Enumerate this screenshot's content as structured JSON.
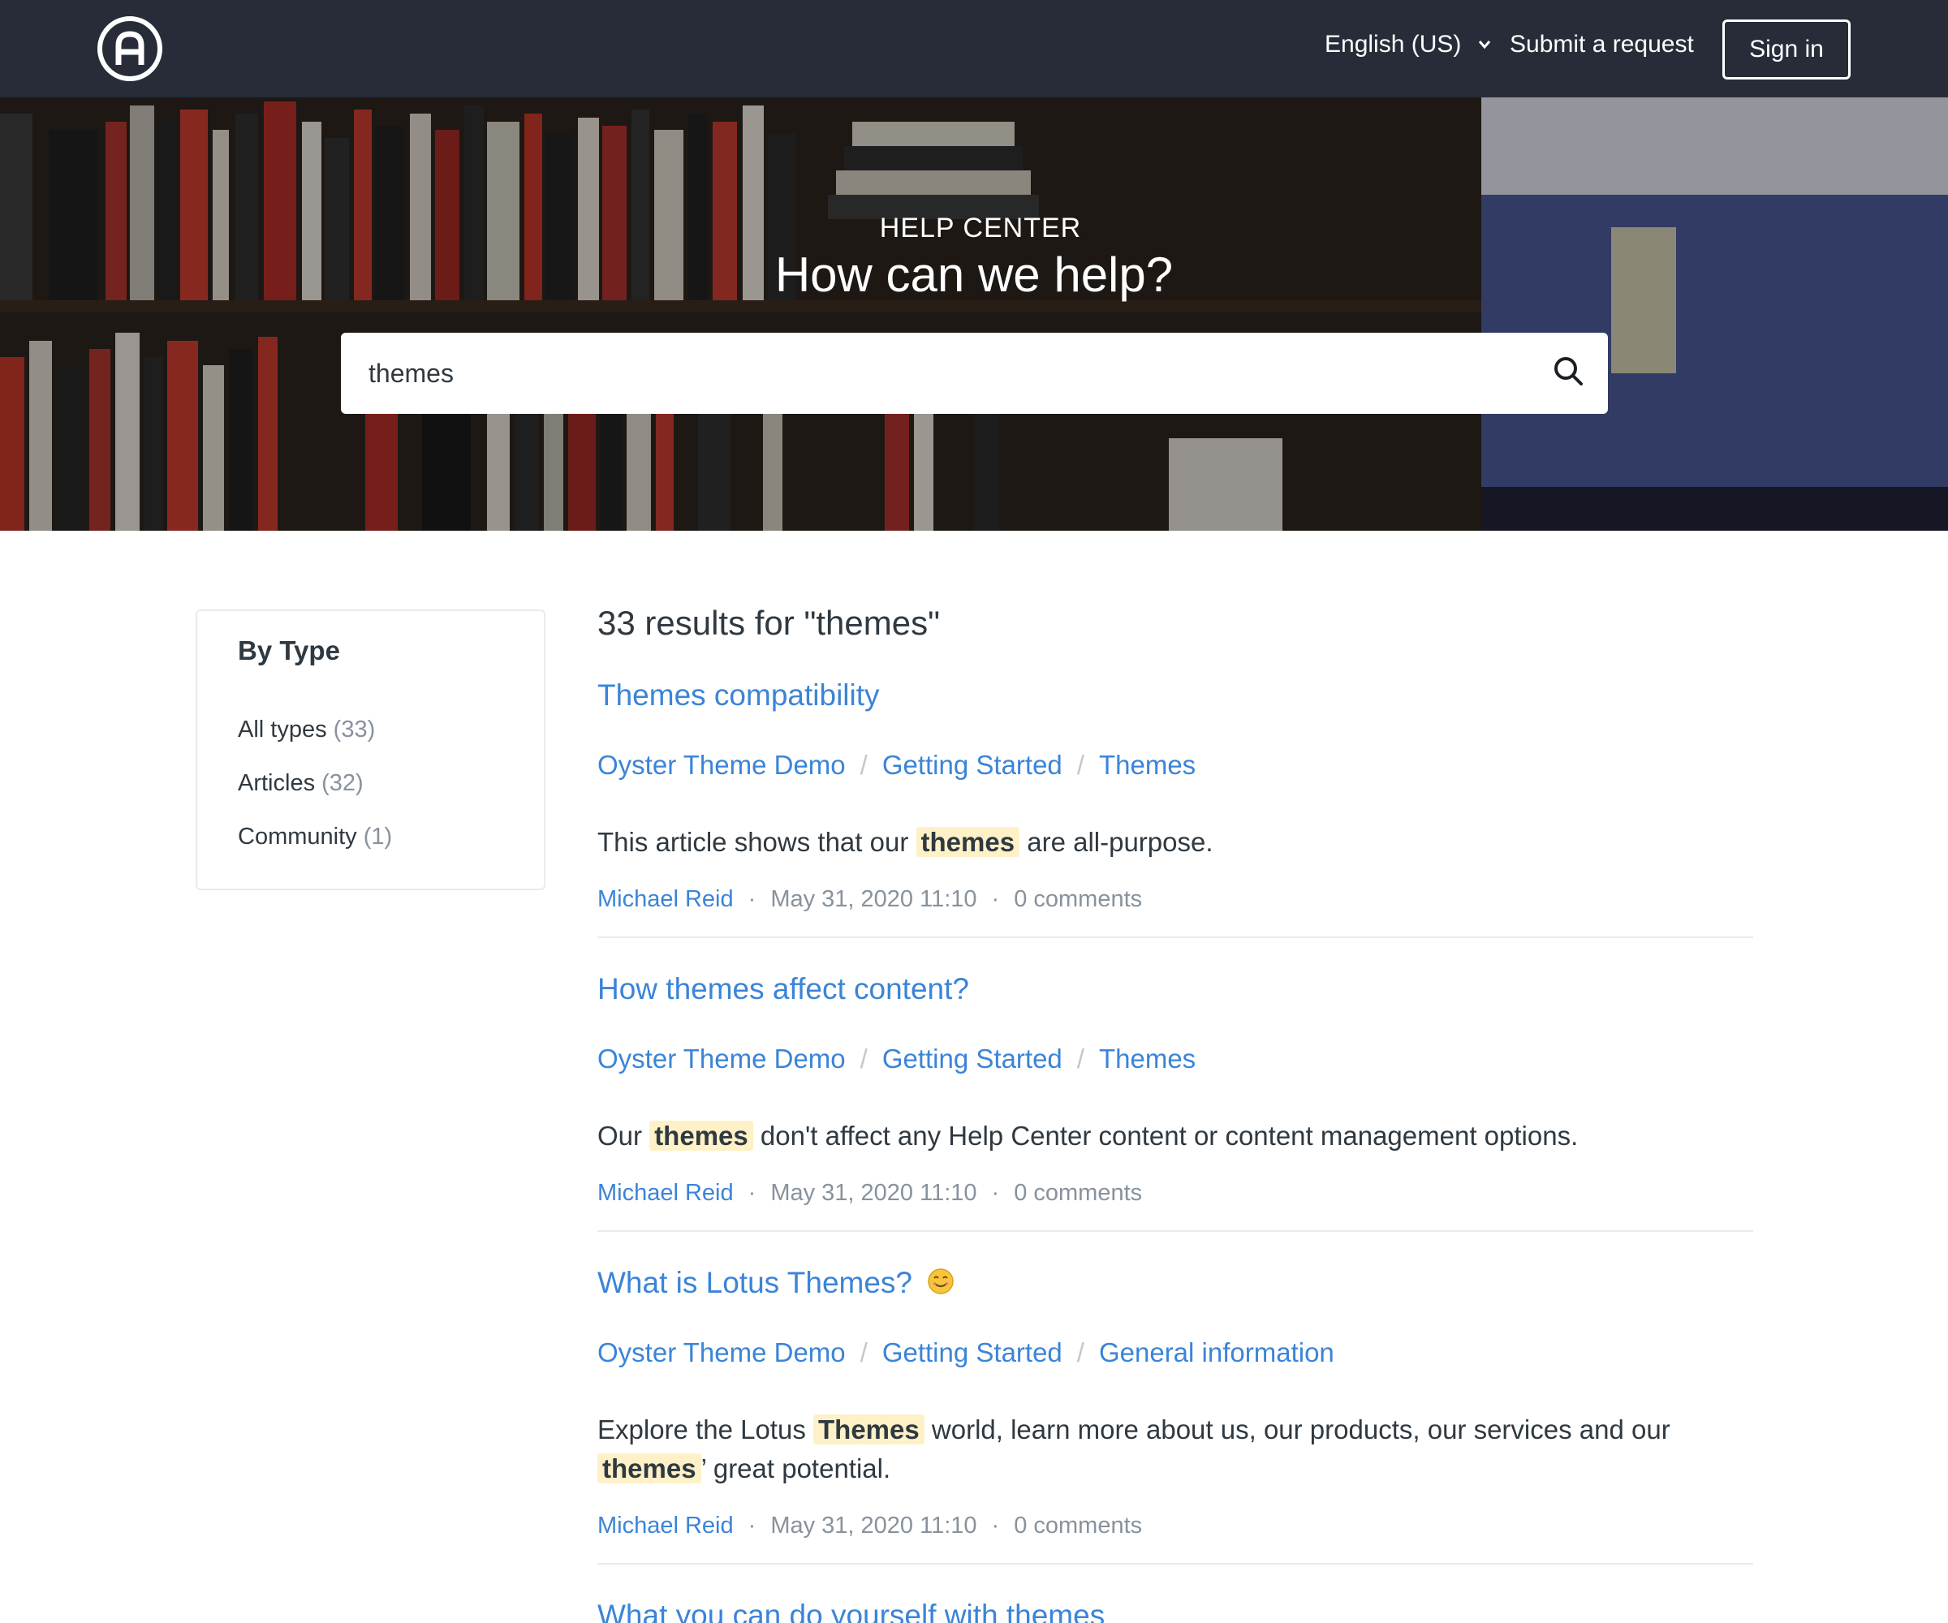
{
  "header": {
    "logo_icon": "letter-a-circle-logo",
    "language": "English (US)",
    "submit_request": "Submit a request",
    "sign_in": "Sign in"
  },
  "hero": {
    "kicker": "HELP CENTER",
    "title": "How can we help?",
    "search_value": "themes"
  },
  "sidebar": {
    "title": "By Type",
    "items": [
      {
        "label": "All types",
        "count": "(33)"
      },
      {
        "label": "Articles",
        "count": "(32)"
      },
      {
        "label": "Community",
        "count": "(1)"
      }
    ]
  },
  "results": {
    "heading": "33 results for \"themes\"",
    "items": [
      {
        "title": "Themes compatibility",
        "crumbs": [
          "Oyster Theme Demo",
          "Getting Started",
          "Themes"
        ],
        "text_before": "This article shows that our",
        "text_hl": "themes",
        "text_after": "are all-purpose.",
        "author": "Michael Reid",
        "date": "May 31, 2020 11:10",
        "comments": "0 comments"
      },
      {
        "title": "How themes affect content?",
        "crumbs": [
          "Oyster Theme Demo",
          "Getting Started",
          "Themes"
        ],
        "text_before": "Our",
        "text_hl": "themes",
        "text_after": "don't affect any Help Center content or content management options.",
        "author": "Michael Reid",
        "date": "May 31, 2020 11:10",
        "comments": "0 comments"
      },
      {
        "title": "What is Lotus Themes?",
        "title_icon": "smiling-face-emoji-icon",
        "crumbs": [
          "Oyster Theme Demo",
          "Getting Started",
          "General information"
        ],
        "text_before": "Explore the Lotus",
        "text_hl": "Themes",
        "text_mid": "world, learn more about us, our products, our services and our",
        "text_hl2": "themes",
        "text_after": "’ great potential.",
        "author": "Michael Reid",
        "date": "May 31, 2020 11:10",
        "comments": "0 comments"
      },
      {
        "title": "What you can do yourself with themes"
      }
    ]
  },
  "colors": {
    "header_bg": "#272c38",
    "link": "#3b84d8",
    "highlight": "#fff1c7",
    "text": "#2f3941",
    "muted": "#87929d"
  }
}
